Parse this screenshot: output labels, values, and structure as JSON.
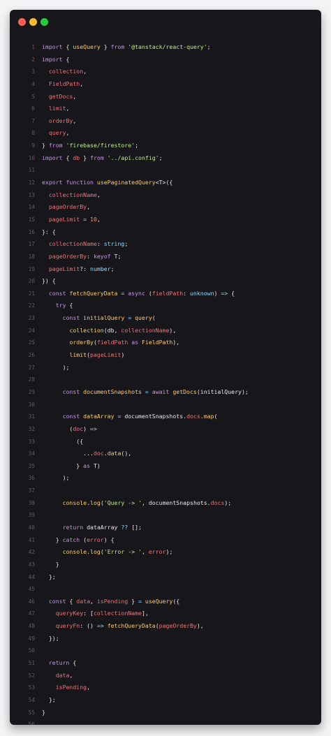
{
  "colors": {
    "background": "#f4f4f6",
    "editor_bg": "#17171b",
    "traffic_red": "#ff5f57",
    "traffic_yellow": "#febc2e",
    "traffic_green": "#28c840"
  },
  "editor": {
    "lines": [
      [
        [
          "kw",
          "import "
        ],
        [
          "punc",
          "{ "
        ],
        [
          "fn",
          "useQuery"
        ],
        [
          "punc",
          " } "
        ],
        [
          "kw",
          "from "
        ],
        [
          "str",
          "'@tanstack/react-query'"
        ],
        [
          "punc",
          ";"
        ]
      ],
      [
        [
          "kw",
          "import "
        ],
        [
          "punc",
          "{"
        ]
      ],
      [
        [
          "punc",
          "  "
        ],
        [
          "var",
          "collection"
        ],
        [
          "punc",
          ","
        ]
      ],
      [
        [
          "punc",
          "  "
        ],
        [
          "var",
          "FieldPath"
        ],
        [
          "punc",
          ","
        ]
      ],
      [
        [
          "punc",
          "  "
        ],
        [
          "var",
          "getDocs"
        ],
        [
          "punc",
          ","
        ]
      ],
      [
        [
          "punc",
          "  "
        ],
        [
          "var",
          "limit"
        ],
        [
          "punc",
          ","
        ]
      ],
      [
        [
          "punc",
          "  "
        ],
        [
          "var",
          "orderBy"
        ],
        [
          "punc",
          ","
        ]
      ],
      [
        [
          "punc",
          "  "
        ],
        [
          "var",
          "query"
        ],
        [
          "punc",
          ","
        ]
      ],
      [
        [
          "punc",
          "} "
        ],
        [
          "kw",
          "from "
        ],
        [
          "str",
          "'firebase/firestore'"
        ],
        [
          "punc",
          ";"
        ]
      ],
      [
        [
          "kw",
          "import "
        ],
        [
          "punc",
          "{ "
        ],
        [
          "var",
          "db"
        ],
        [
          "punc",
          " } "
        ],
        [
          "kw",
          "from "
        ],
        [
          "str",
          "'../api.config'"
        ],
        [
          "punc",
          ";"
        ]
      ],
      [],
      [
        [
          "kw",
          "export function "
        ],
        [
          "fn",
          "usePaginatedQuery"
        ],
        [
          "punc",
          "<T>({"
        ]
      ],
      [
        [
          "punc",
          "  "
        ],
        [
          "var",
          "collectionName"
        ],
        [
          "punc",
          ","
        ]
      ],
      [
        [
          "punc",
          "  "
        ],
        [
          "var",
          "pageOrderBy"
        ],
        [
          "punc",
          ","
        ]
      ],
      [
        [
          "punc",
          "  "
        ],
        [
          "var",
          "pageLimit"
        ],
        [
          "op",
          " = "
        ],
        [
          "num",
          "10"
        ],
        [
          "punc",
          ","
        ]
      ],
      [
        [
          "punc",
          "}: {"
        ]
      ],
      [
        [
          "punc",
          "  "
        ],
        [
          "var",
          "collectionName"
        ],
        [
          "punc",
          ": "
        ],
        [
          "type",
          "string"
        ],
        [
          "punc",
          ";"
        ]
      ],
      [
        [
          "punc",
          "  "
        ],
        [
          "var",
          "pageOrderBy"
        ],
        [
          "punc",
          ": "
        ],
        [
          "kw",
          "keyof "
        ],
        [
          "punc",
          "T;"
        ]
      ],
      [
        [
          "punc",
          "  "
        ],
        [
          "var",
          "pageLimit"
        ],
        [
          "punc",
          "?: "
        ],
        [
          "type",
          "number"
        ],
        [
          "punc",
          ";"
        ]
      ],
      [
        [
          "punc",
          "}) {"
        ]
      ],
      [
        [
          "punc",
          "  "
        ],
        [
          "kw",
          "const "
        ],
        [
          "fn",
          "fetchQueryData"
        ],
        [
          "op",
          " = "
        ],
        [
          "kw",
          "async "
        ],
        [
          "punc",
          "("
        ],
        [
          "var",
          "fieldPath"
        ],
        [
          "punc",
          ": "
        ],
        [
          "type",
          "unknown"
        ],
        [
          "punc",
          ") "
        ],
        [
          "op",
          "=> "
        ],
        [
          "punc",
          "{"
        ]
      ],
      [
        [
          "punc",
          "    "
        ],
        [
          "kw",
          "try "
        ],
        [
          "punc",
          "{"
        ]
      ],
      [
        [
          "punc",
          "      "
        ],
        [
          "kw",
          "const "
        ],
        [
          "fn",
          "initialQuery"
        ],
        [
          "op",
          " = "
        ],
        [
          "fn",
          "query"
        ],
        [
          "punc",
          "("
        ]
      ],
      [
        [
          "punc",
          "        "
        ],
        [
          "fn",
          "collection"
        ],
        [
          "punc",
          "(db, "
        ],
        [
          "var",
          "collectionName"
        ],
        [
          "punc",
          "),"
        ]
      ],
      [
        [
          "punc",
          "        "
        ],
        [
          "fn",
          "orderBy"
        ],
        [
          "punc",
          "("
        ],
        [
          "var",
          "fieldPath"
        ],
        [
          "kw",
          " as "
        ],
        [
          "fn",
          "FieldPath"
        ],
        [
          "punc",
          "),"
        ]
      ],
      [
        [
          "punc",
          "        "
        ],
        [
          "fn",
          "limit"
        ],
        [
          "punc",
          "("
        ],
        [
          "var",
          "pageLimit"
        ],
        [
          "punc",
          ")"
        ]
      ],
      [
        [
          "punc",
          "      );"
        ]
      ],
      [],
      [
        [
          "punc",
          "      "
        ],
        [
          "kw",
          "const "
        ],
        [
          "fn",
          "documentSnapshots"
        ],
        [
          "op",
          " = "
        ],
        [
          "kw",
          "await "
        ],
        [
          "fn",
          "getDocs"
        ],
        [
          "punc",
          "(initialQuery);"
        ]
      ],
      [],
      [
        [
          "punc",
          "      "
        ],
        [
          "kw",
          "const "
        ],
        [
          "fn",
          "dataArray"
        ],
        [
          "op",
          " = "
        ],
        [
          "punc",
          "documentSnapshots."
        ],
        [
          "var",
          "docs"
        ],
        [
          "punc",
          "."
        ],
        [
          "fn",
          "map"
        ],
        [
          "punc",
          "("
        ]
      ],
      [
        [
          "punc",
          "        ("
        ],
        [
          "var",
          "doc"
        ],
        [
          "punc",
          ") "
        ],
        [
          "op",
          "=>"
        ]
      ],
      [
        [
          "punc",
          "          ({"
        ]
      ],
      [
        [
          "punc",
          "            ..."
        ],
        [
          "var",
          "doc"
        ],
        [
          "punc",
          "."
        ],
        [
          "fn",
          "data"
        ],
        [
          "punc",
          "(),"
        ]
      ],
      [
        [
          "punc",
          "          }"
        ],
        [
          "kw",
          " as "
        ],
        [
          "punc",
          "T)"
        ]
      ],
      [
        [
          "punc",
          "      );"
        ]
      ],
      [],
      [
        [
          "punc",
          "      "
        ],
        [
          "fn",
          "console"
        ],
        [
          "punc",
          "."
        ],
        [
          "fn",
          "log"
        ],
        [
          "punc",
          "("
        ],
        [
          "str",
          "'Query -> '"
        ],
        [
          "punc",
          ", documentSnapshots."
        ],
        [
          "var",
          "docs"
        ],
        [
          "punc",
          ");"
        ]
      ],
      [],
      [
        [
          "punc",
          "      "
        ],
        [
          "kw",
          "return "
        ],
        [
          "punc",
          "dataArray "
        ],
        [
          "op",
          "?? "
        ],
        [
          "punc",
          "[];"
        ]
      ],
      [
        [
          "punc",
          "    } "
        ],
        [
          "kw",
          "catch "
        ],
        [
          "punc",
          "("
        ],
        [
          "var",
          "error"
        ],
        [
          "punc",
          ") {"
        ]
      ],
      [
        [
          "punc",
          "      "
        ],
        [
          "fn",
          "console"
        ],
        [
          "punc",
          "."
        ],
        [
          "fn",
          "log"
        ],
        [
          "punc",
          "("
        ],
        [
          "str",
          "'Error -> '"
        ],
        [
          "punc",
          ", "
        ],
        [
          "var",
          "error"
        ],
        [
          "punc",
          ");"
        ]
      ],
      [
        [
          "punc",
          "    }"
        ]
      ],
      [
        [
          "punc",
          "  };"
        ]
      ],
      [],
      [
        [
          "punc",
          "  "
        ],
        [
          "kw",
          "const "
        ],
        [
          "punc",
          "{ "
        ],
        [
          "var",
          "data"
        ],
        [
          "punc",
          ", "
        ],
        [
          "var",
          "isPending"
        ],
        [
          "punc",
          " } "
        ],
        [
          "op",
          "= "
        ],
        [
          "fn",
          "useQuery"
        ],
        [
          "punc",
          "({"
        ]
      ],
      [
        [
          "punc",
          "    "
        ],
        [
          "var",
          "queryKey"
        ],
        [
          "punc",
          ": ["
        ],
        [
          "var",
          "collectionName"
        ],
        [
          "punc",
          "],"
        ]
      ],
      [
        [
          "punc",
          "    "
        ],
        [
          "var",
          "queryFn"
        ],
        [
          "punc",
          ": () "
        ],
        [
          "op",
          "=> "
        ],
        [
          "fn",
          "fetchQueryData"
        ],
        [
          "punc",
          "("
        ],
        [
          "var",
          "pageOrderBy"
        ],
        [
          "punc",
          "),"
        ]
      ],
      [
        [
          "punc",
          "  });"
        ]
      ],
      [],
      [
        [
          "punc",
          "  "
        ],
        [
          "kw",
          "return "
        ],
        [
          "punc",
          "{"
        ]
      ],
      [
        [
          "punc",
          "    "
        ],
        [
          "var",
          "data"
        ],
        [
          "punc",
          ","
        ]
      ],
      [
        [
          "punc",
          "    "
        ],
        [
          "var",
          "isPending"
        ],
        [
          "punc",
          ","
        ]
      ],
      [
        [
          "punc",
          "  };"
        ]
      ],
      [
        [
          "punc",
          "}"
        ]
      ],
      []
    ]
  }
}
